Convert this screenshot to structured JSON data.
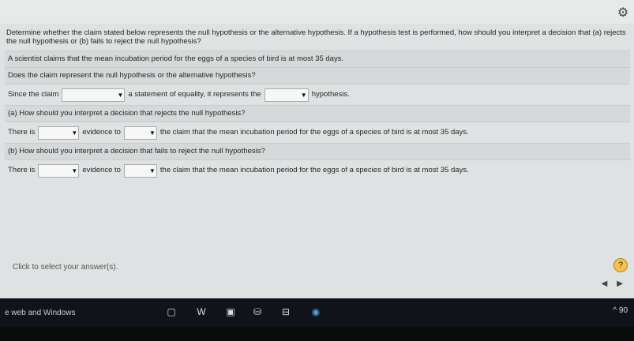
{
  "question": {
    "prompt": "Determine whether the claim stated below represents the null hypothesis or the alternative hypothesis. If a hypothesis test is performed, how should you interpret a decision that (a) rejects the null hypothesis or (b) fails to reject the null hypothesis?",
    "claim": "A scientist claims that the mean incubation period for the eggs of a species of bird is at most 35 days."
  },
  "part1": {
    "question": "Does the claim represent the null hypothesis or the alternative hypothesis?",
    "line_start": "Since the claim",
    "line_mid": "a statement of equality, it represents the",
    "line_end": "hypothesis."
  },
  "partA": {
    "question": "(a) How should you interpret a decision that rejects the null hypothesis?",
    "line_start": "There is",
    "line_mid": "evidence to",
    "line_end": "the claim that the mean incubation period for the eggs of a species of bird is at most 35 days."
  },
  "partB": {
    "question": "(b) How should you interpret a decision that fails to reject the null hypothesis?",
    "line_start": "There is",
    "line_mid": "evidence to",
    "line_end": "the claim that the mean incubation period for the eggs of a species of bird is at most 35 days."
  },
  "footer": {
    "hint": "Click to select your answer(s).",
    "help": "?"
  },
  "taskbar": {
    "search_text": "e web and Windows",
    "tray_text": "^ 90"
  },
  "icons": {
    "gear": "gear-icon",
    "dropdown_arrow": "▼",
    "nav_left": "◀",
    "nav_right": "▶",
    "taskview": "▢",
    "word": "W",
    "files": "▣",
    "store": "⛁",
    "media": "⊟",
    "edge": "◉"
  }
}
